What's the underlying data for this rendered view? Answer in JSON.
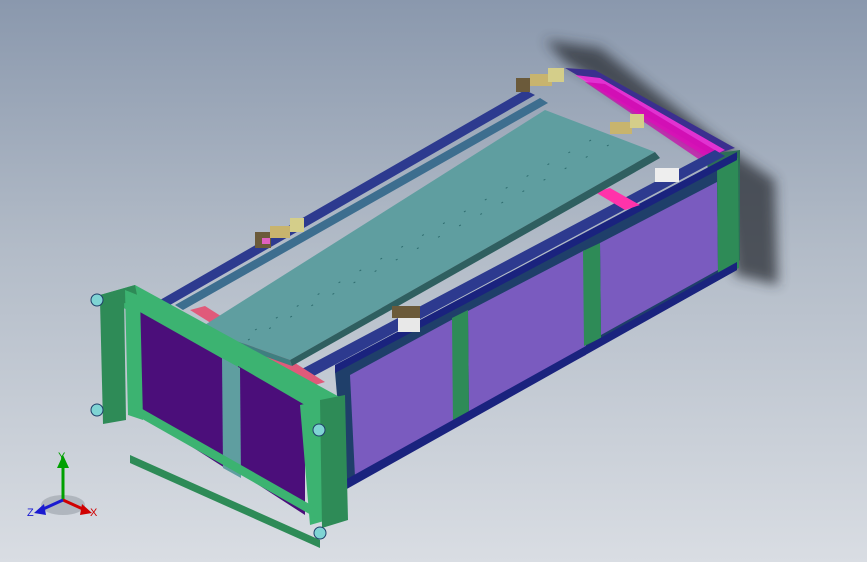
{
  "viewport": {
    "background_top": "#8a98ad",
    "background_bottom": "#d9dde3"
  },
  "model": {
    "panel_color": "#7a5bbf",
    "frame_color": "#2e8b57",
    "end_frame_color": "#3cb371",
    "plate_color": "#5f9ea0",
    "accent_color": "#ff00cc"
  },
  "triad": {
    "x_label": "X",
    "y_label": "Y",
    "z_label": "Z",
    "x_color": "#d00000",
    "y_color": "#00a000",
    "z_color": "#1a1ad0"
  }
}
